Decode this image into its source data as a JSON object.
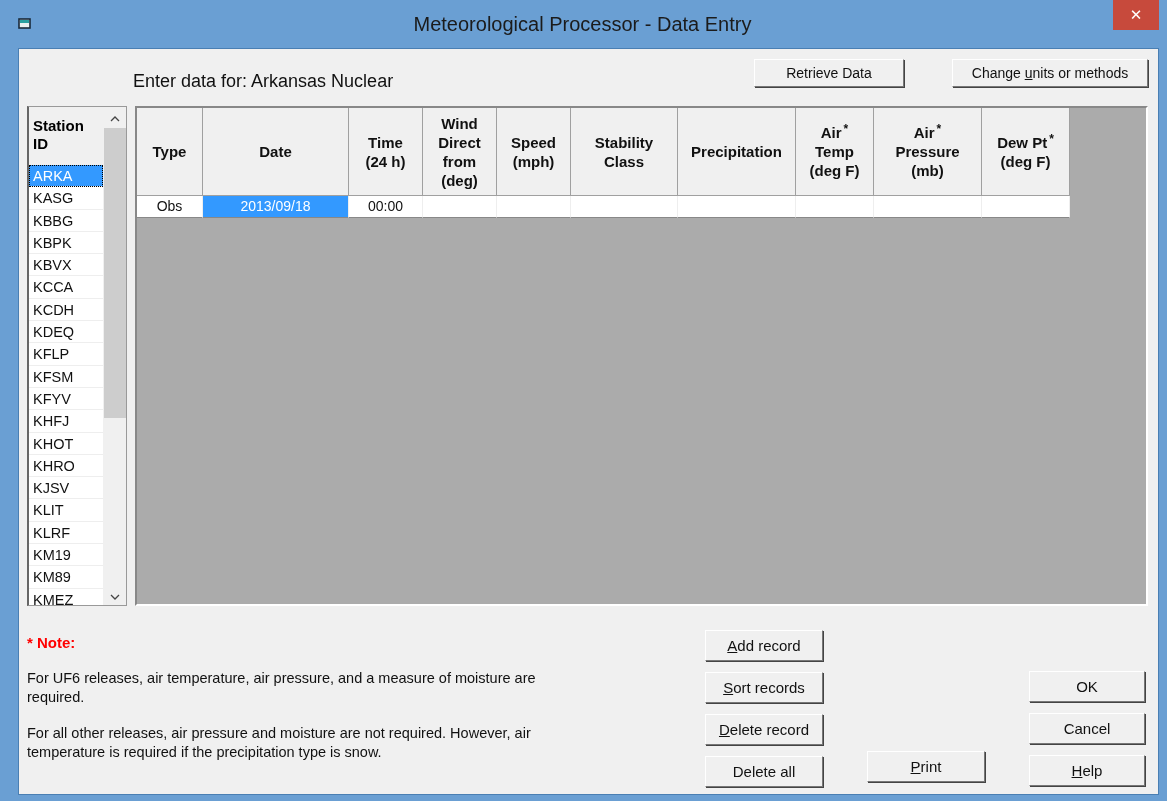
{
  "window": {
    "title": "Meteorological Processor - Data Entry",
    "close": "✕"
  },
  "heading": "Enter data for: Arkansas Nuclear",
  "top_buttons": [
    {
      "pre": "Retrieve Data"
    },
    {
      "pre": "Change ",
      "key": "u",
      "post": "nits or methods"
    }
  ],
  "stations": {
    "header": "Station ID",
    "items": [
      {
        "label": "ARKA",
        "selected": true
      },
      {
        "label": "KASG",
        "selected": false
      },
      {
        "label": "KBBG",
        "selected": false
      },
      {
        "label": "KBPK",
        "selected": false
      },
      {
        "label": "KBVX",
        "selected": false
      },
      {
        "label": "KCCA",
        "selected": false
      },
      {
        "label": "KCDH",
        "selected": false
      },
      {
        "label": "KDEQ",
        "selected": false
      },
      {
        "label": "KFLP",
        "selected": false
      },
      {
        "label": "KFSM",
        "selected": false
      },
      {
        "label": "KFYV",
        "selected": false
      },
      {
        "label": "KHFJ",
        "selected": false
      },
      {
        "label": "KHOT",
        "selected": false
      },
      {
        "label": "KHRO",
        "selected": false
      },
      {
        "label": "KJSV",
        "selected": false
      },
      {
        "label": "KLIT",
        "selected": false
      },
      {
        "label": "KLRF",
        "selected": false
      },
      {
        "label": "KM19",
        "selected": false
      },
      {
        "label": "KM89",
        "selected": false
      },
      {
        "label": "KMEZ",
        "selected": false
      }
    ]
  },
  "table": {
    "columns": [
      {
        "lines": [
          "Type"
        ]
      },
      {
        "lines": [
          "Date"
        ]
      },
      {
        "lines": [
          "Time",
          "(24 h)"
        ]
      },
      {
        "lines": [
          "Wind",
          "Direct",
          "from",
          "(deg)"
        ]
      },
      {
        "lines": [
          "Speed",
          "(mph)"
        ]
      },
      {
        "lines": [
          "Stability",
          "Class"
        ]
      },
      {
        "lines": [
          "Precipitation"
        ]
      },
      {
        "lines": [
          "Air",
          "Temp",
          "(deg F)"
        ],
        "star": "*"
      },
      {
        "lines": [
          "Air",
          "Pressure",
          "(mb)"
        ],
        "star": "*"
      },
      {
        "lines": [
          "Dew Pt",
          "(deg F)"
        ],
        "star": "*"
      }
    ],
    "rows": [
      {
        "cells": [
          {
            "text": "Obs",
            "selected": false
          },
          {
            "text": "2013/09/18",
            "selected": true
          },
          {
            "text": "00:00",
            "selected": false
          },
          {
            "selected": false
          },
          {
            "selected": false
          },
          {
            "selected": false
          },
          {
            "selected": false
          },
          {
            "selected": false
          },
          {
            "selected": false
          },
          {
            "selected": false
          }
        ]
      }
    ]
  },
  "note": {
    "title": "* Note:",
    "paragraphs": [
      "For UF6 releases, air temperature, air pressure, and a measure of moisture are required.",
      "For all other releases, air pressure and moisture are not required. However, air temperature is required if the precipitation type is snow."
    ]
  },
  "buttons": {
    "left": [
      {
        "key": "A",
        "post": "dd record"
      },
      {
        "key": "S",
        "post": "ort records"
      },
      {
        "key": "D",
        "post": "elete record"
      },
      {
        "pre": "Delete all"
      }
    ],
    "middle": [
      {
        "key": "P",
        "post": "rint"
      }
    ],
    "right": [
      {
        "pre": "OK"
      },
      {
        "pre": "Cancel"
      },
      {
        "key": "H",
        "post": "elp"
      }
    ]
  }
}
